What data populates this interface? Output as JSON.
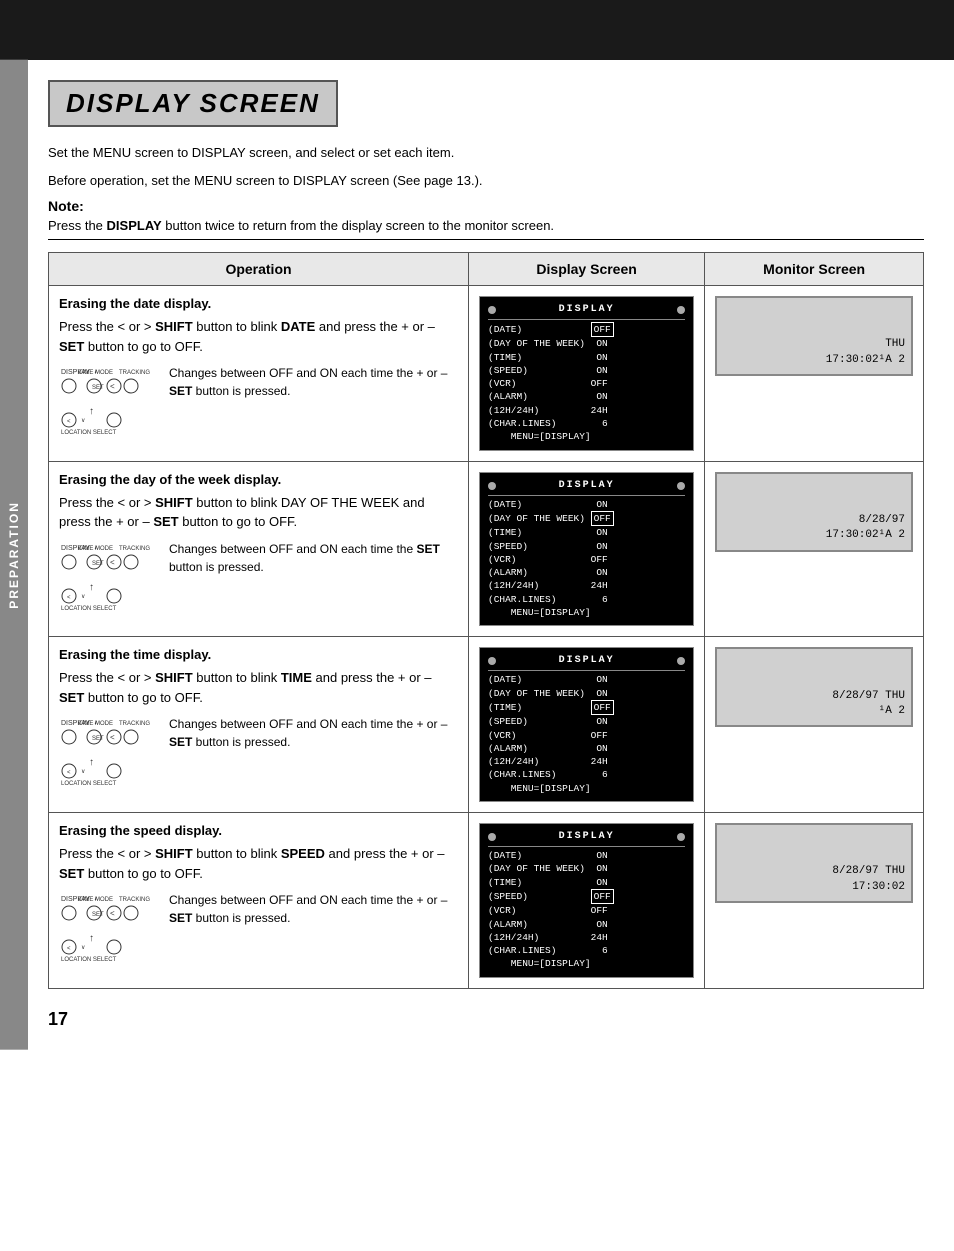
{
  "top_bar": {},
  "page_title": "DISPLAY SCREEN",
  "intro": {
    "line1": "Set the MENU screen to DISPLAY screen, and select or set each item.",
    "line2": "Before operation, set the MENU screen to DISPLAY screen (See page 13.)."
  },
  "note": {
    "label": "Note:",
    "text_before": "Press the ",
    "bold_word": "DISPLAY",
    "text_after": " button twice to return from the display screen to the monitor screen."
  },
  "table": {
    "headers": [
      "Operation",
      "Display Screen",
      "Monitor Screen"
    ],
    "rows": [
      {
        "title": "Erasing the date display.",
        "desc": "Press the  <  or  >  SHIFT button to blink DATE and press the + or – SET button to go to OFF.",
        "change_desc": "Changes between OFF and ON each time the + or – SET button is pressed.",
        "display_lines": [
          {
            "text": "(DATE)            OFF",
            "highlight": "OFF"
          },
          {
            "text": "(DAY OF THE WEEK)  ON"
          },
          {
            "text": "(TIME)             ON"
          },
          {
            "text": "(SPEED)            ON"
          },
          {
            "text": "(VCR)             OFF"
          },
          {
            "text": "(ALARM)            ON"
          },
          {
            "text": "(12H/24H)         24H"
          },
          {
            "text": "(CHAR.LINES)        6"
          },
          {
            "text": "    MENU=[DISPLAY]"
          }
        ],
        "monitor_text": "THU\n17:30:02¹A 2"
      },
      {
        "title": "Erasing the day of the week display.",
        "desc": "Press the  <  or  >  SHIFT button to blink DAY OF THE WEEK and press the + or – SET button to go to OFF.",
        "change_desc": "Changes between OFF and ON each time the SET button is pressed.",
        "display_lines": [
          {
            "text": "(DATE)             ON"
          },
          {
            "text": "(DAY OF THE WEEK) OFF",
            "highlight": "OFF"
          },
          {
            "text": "(TIME)             ON"
          },
          {
            "text": "(SPEED)            ON"
          },
          {
            "text": "(VCR)             OFF"
          },
          {
            "text": "(ALARM)            ON"
          },
          {
            "text": "(12H/24H)         24H"
          },
          {
            "text": "(CHAR.LINES)        6"
          },
          {
            "text": "    MENU=[DISPLAY]"
          }
        ],
        "monitor_text": "8/28/97\n17:30:02¹A 2"
      },
      {
        "title": "Erasing the time display.",
        "desc": "Press the  <  or  >  SHIFT button to blink TIME and press the + or – SET button to go to OFF.",
        "change_desc": "Changes between OFF and ON each time the + or – SET button is pressed.",
        "display_lines": [
          {
            "text": "(DATE)             ON"
          },
          {
            "text": "(DAY OF THE WEEK)  ON"
          },
          {
            "text": "(TIME)            OFF",
            "highlight": "OFF"
          },
          {
            "text": "(SPEED)            ON"
          },
          {
            "text": "(VCR)             OFF"
          },
          {
            "text": "(ALARM)            ON"
          },
          {
            "text": "(12H/24H)         24H"
          },
          {
            "text": "(CHAR.LINES)        6"
          },
          {
            "text": "    MENU=[DISPLAY]"
          }
        ],
        "monitor_text": "8/28/97 THU\n¹A 2"
      },
      {
        "title": "Erasing the speed display.",
        "desc": "Press the  <  or  >  SHIFT button to blink SPEED and press the + or – SET button to go to OFF.",
        "change_desc": "Changes between OFF and ON each time the + or – SET button is pressed.",
        "display_lines": [
          {
            "text": "(DATE)             ON"
          },
          {
            "text": "(DAY OF THE WEEK)  ON"
          },
          {
            "text": "(TIME)             ON"
          },
          {
            "text": "(SPEED)           OFF",
            "highlight": "OFF"
          },
          {
            "text": "(VCR)             OFF"
          },
          {
            "text": "(ALARM)            ON"
          },
          {
            "text": "(12H/24H)         24H"
          },
          {
            "text": "(CHAR.LINES)        6"
          },
          {
            "text": "    MENU=[DISPLAY]"
          }
        ],
        "monitor_text": "8/28/97 THU\n17:30:02"
      }
    ]
  },
  "page_number": "17"
}
